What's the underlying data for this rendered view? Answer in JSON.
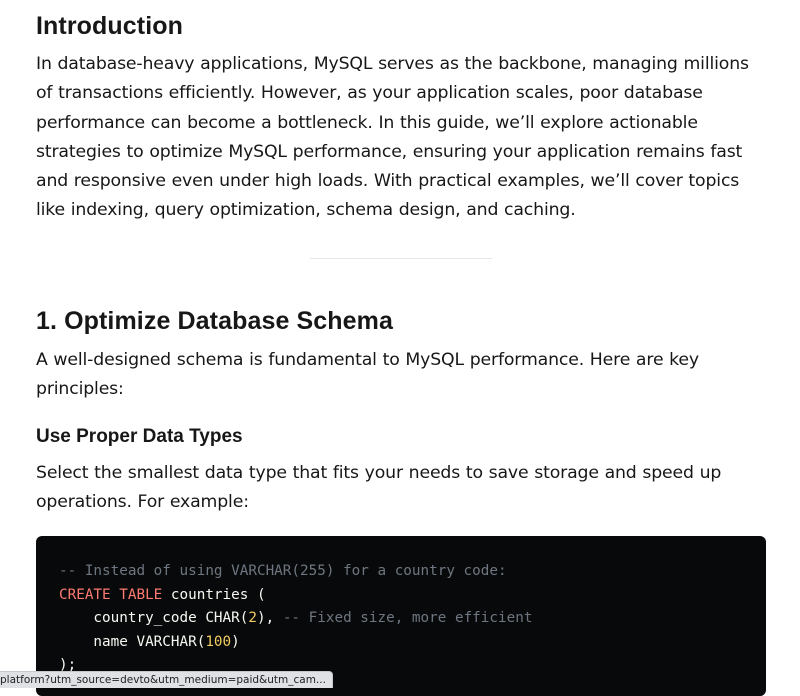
{
  "intro": {
    "heading": "Introduction",
    "paragraph": "In database-heavy applications, MySQL serves as the backbone, managing millions of transactions efficiently. However, as your application scales, poor database performance can become a bottleneck. In this guide, we’ll explore actionable strategies to optimize MySQL performance, ensuring your application remains fast and responsive even under high loads. With practical examples, we’ll cover topics like indexing, query optimization, schema design, and caching."
  },
  "section1": {
    "heading": "1. Optimize Database Schema",
    "paragraph": "A well-designed schema is fundamental to MySQL performance. Here are key principles:",
    "subheading": "Use Proper Data Types",
    "sub_paragraph": "Select the smallest data type that fits your needs to save storage and speed up operations. For example:"
  },
  "code_block": {
    "comment1": "-- Instead of using VARCHAR(255) for a country code:",
    "create_kw": "CREATE TABLE",
    "table_name": " countries (",
    "col1_name": "    country_code CHAR(",
    "col1_size": "2",
    "col1_end": "), ",
    "comment2": "-- Fixed size, more efficient",
    "col2_name": "    name VARCHAR(",
    "col2_size": "100",
    "col2_end": ")",
    "closing": ");"
  },
  "status_bar": {
    "url": "platform?utm_source=devto&utm_medium=paid&utm_cam..."
  }
}
